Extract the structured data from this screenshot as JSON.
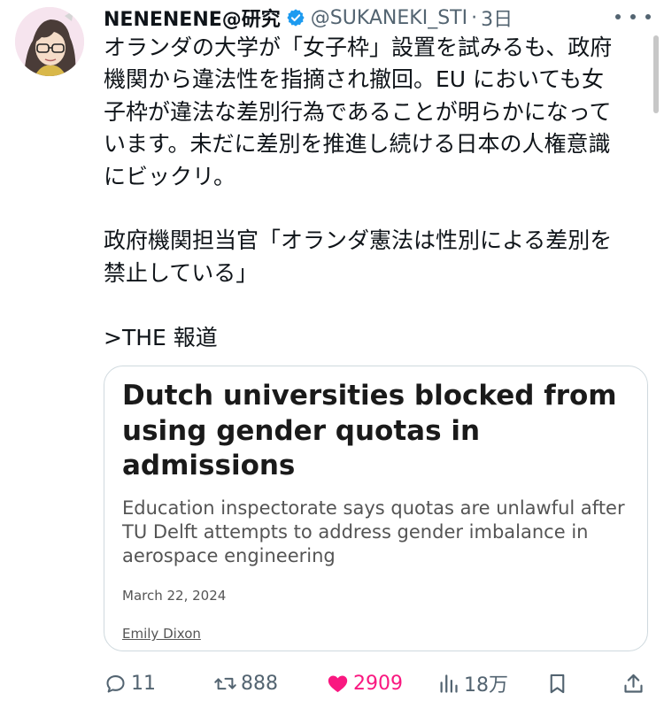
{
  "tweet": {
    "display_name": "NENENENE@研究",
    "handle": "@SUKANEKI_STI",
    "separator": "·",
    "time": "3日",
    "verified_color": "#1d9bf0",
    "text_lines": [
      "オランダの大学が「女子枠」設置を試みるも、政府",
      "機関から違法性を指摘され撤回。EU においても女",
      "子枠が違法な差別行為であることが明らかになって",
      "います。未だに差別を推進し続ける日本の人権意識",
      "にビックリ。"
    ],
    "quote_lines": [
      "政府機関担当官「オランダ憲法は性別による差別を",
      "禁止している」"
    ],
    "source_line": ">THE 報道",
    "icons": {
      "avatar": "anime-avatar",
      "verified": "verified-badge-icon",
      "more": "more-options-icon"
    }
  },
  "card": {
    "headline": "Dutch universities blocked from using gender quotas in admissions",
    "subtitle": "Education inspectorate says quotas are unlawful after TU Delft attempts to address gender imbalance in aerospace engineering",
    "date": "March 22, 2024",
    "author": "Emily Dixon"
  },
  "actions": {
    "reply": {
      "icon": "reply-icon",
      "count": "11"
    },
    "retweet": {
      "icon": "retweet-icon",
      "count": "888"
    },
    "like": {
      "icon": "heart-icon",
      "count": "2909",
      "color": "#f91880"
    },
    "views": {
      "icon": "views-icon",
      "count": "18万"
    },
    "bookmark": {
      "icon": "bookmark-icon"
    },
    "share": {
      "icon": "share-icon"
    }
  }
}
